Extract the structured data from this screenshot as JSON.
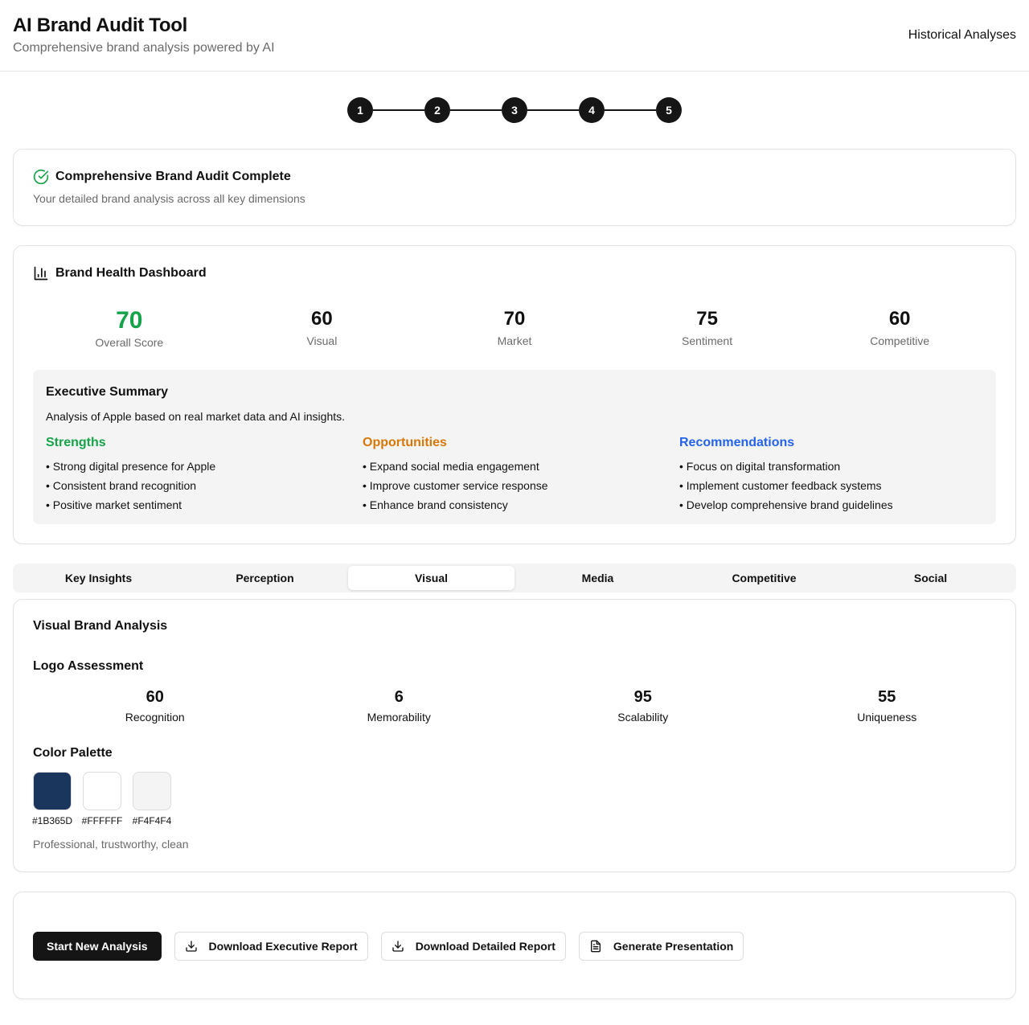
{
  "header": {
    "title": "AI Brand Audit Tool",
    "subtitle": "Comprehensive brand analysis powered by AI",
    "historical_link": "Historical Analyses"
  },
  "stepper": {
    "steps": [
      "1",
      "2",
      "3",
      "4",
      "5"
    ]
  },
  "completion": {
    "icon": "check-circle-icon",
    "title": "Comprehensive Brand Audit Complete",
    "subtitle": "Your detailed brand analysis across all key dimensions"
  },
  "dashboard": {
    "icon": "bar-chart-icon",
    "title": "Brand Health Dashboard",
    "metrics": [
      {
        "value": "70",
        "label": "Overall Score"
      },
      {
        "value": "60",
        "label": "Visual"
      },
      {
        "value": "70",
        "label": "Market"
      },
      {
        "value": "75",
        "label": "Sentiment"
      },
      {
        "value": "60",
        "label": "Competitive"
      }
    ],
    "summary": {
      "title": "Executive Summary",
      "text": "Analysis of Apple based on real market data and AI insights.",
      "strengths": {
        "heading": "Strengths",
        "items": [
          "• Strong digital presence for Apple",
          "• Consistent brand recognition",
          "• Positive market sentiment"
        ]
      },
      "opportunities": {
        "heading": "Opportunities",
        "items": [
          "• Expand social media engagement",
          "• Improve customer service response",
          "• Enhance brand consistency"
        ]
      },
      "recommendations": {
        "heading": "Recommendations",
        "items": [
          "• Focus on digital transformation",
          "• Implement customer feedback systems",
          "• Develop comprehensive brand guidelines"
        ]
      }
    }
  },
  "tabs": {
    "items": [
      "Key Insights",
      "Perception",
      "Visual",
      "Media",
      "Competitive",
      "Social"
    ],
    "active": "Visual"
  },
  "visual": {
    "title": "Visual Brand Analysis",
    "logo_title": "Logo Assessment",
    "logo_metrics": [
      {
        "value": "60",
        "label": "Recognition"
      },
      {
        "value": "6",
        "label": "Memorability"
      },
      {
        "value": "95",
        "label": "Scalability"
      },
      {
        "value": "55",
        "label": "Uniqueness"
      }
    ],
    "palette_title": "Color Palette",
    "palette": [
      {
        "hex": "#1B365D",
        "label": "#1B365D"
      },
      {
        "hex": "#FFFFFF",
        "label": "#FFFFFF"
      },
      {
        "hex": "#F4F4F4",
        "label": "#F4F4F4"
      }
    ],
    "palette_description": "Professional, trustworthy, clean"
  },
  "actions": {
    "start_new": "Start New Analysis",
    "download_executive": "Download Executive Report",
    "download_detailed": "Download Detailed Report",
    "generate_presentation": "Generate Presentation"
  },
  "colors": {
    "accent_green": "#16a34a",
    "accent_amber": "#d97706",
    "accent_blue": "#2563eb",
    "primary_dark": "#151515"
  }
}
